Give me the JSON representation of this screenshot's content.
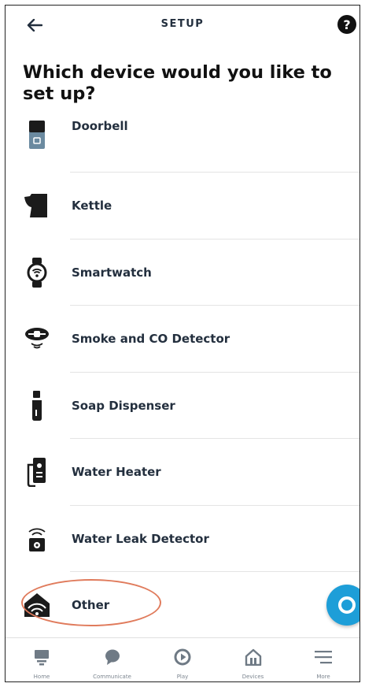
{
  "header": {
    "title": "SETUP",
    "back_icon": "arrow-left-icon",
    "help_label": "?"
  },
  "page": {
    "title": "Which device would you like to set up?"
  },
  "devices": [
    {
      "label": "Doorbell",
      "icon": "doorbell-icon"
    },
    {
      "label": "Kettle",
      "icon": "kettle-icon"
    },
    {
      "label": "Smartwatch",
      "icon": "smartwatch-icon"
    },
    {
      "label": "Smoke and CO Detector",
      "icon": "smoke-detector-icon"
    },
    {
      "label": "Soap Dispenser",
      "icon": "soap-dispenser-icon"
    },
    {
      "label": "Water Heater",
      "icon": "water-heater-icon"
    },
    {
      "label": "Water Leak Detector",
      "icon": "water-leak-detector-icon"
    },
    {
      "label": "Other",
      "icon": "other-device-icon"
    }
  ],
  "annotation": {
    "color": "#e07b5c",
    "highlighted_item": "Other"
  },
  "fab": {
    "icon": "alexa-icon",
    "color": "#1d9ed8"
  },
  "bottom_nav": [
    {
      "label": "Home",
      "icon": "home-icon"
    },
    {
      "label": "Communicate",
      "icon": "chat-icon"
    },
    {
      "label": "Play",
      "icon": "play-icon"
    },
    {
      "label": "Devices",
      "icon": "devices-icon"
    },
    {
      "label": "More",
      "icon": "menu-icon"
    }
  ]
}
